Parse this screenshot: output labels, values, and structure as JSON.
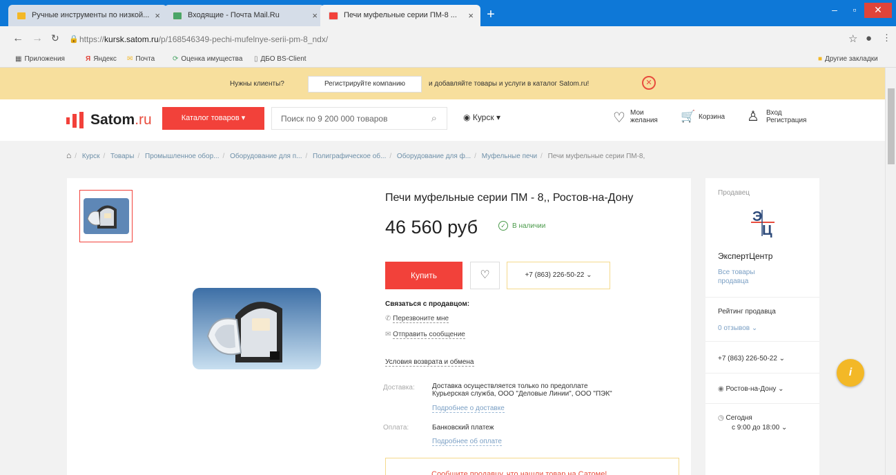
{
  "browser": {
    "tabs": [
      {
        "title": "Ручные инструменты по низкой..."
      },
      {
        "title": "Входящие - Почта Mail.Ru"
      },
      {
        "title": "Печи муфельные серии ПМ-8 ..."
      }
    ],
    "url_host": "kursk.satom.ru",
    "url_prefix": "https://",
    "url_path": "/p/168546349-pechi-mufelnye-serii-pm-8_ndx/",
    "bookmarks": [
      "Приложения",
      "Яндекс",
      "Почта",
      "Оценка имущества",
      "ДБО BS-Client"
    ],
    "other_bookmarks": "Другие закладки"
  },
  "promo": {
    "question": "Нужны клиенты?",
    "register_label": "Регистрируйте компанию",
    "text": "и добавляйте товары и услуги в каталог Satom.ru!"
  },
  "header": {
    "logo_main": "Satom",
    "logo_domain": ".ru",
    "catalog_label": "Каталог товаров",
    "search_placeholder": "Поиск по 9 200 000 товаров",
    "city": "Курск",
    "wishlist_l1": "Мои",
    "wishlist_l2": "желания",
    "cart_label": "Корзина",
    "login_l1": "Вход",
    "login_l2": "Регистрация"
  },
  "breadcrumbs": [
    "Курск",
    "Товары",
    "Промышленное обор...",
    "Оборудование для п...",
    "Полиграфическое об...",
    "Оборудование для ф...",
    "Муфельные печи",
    "Печи муфельные серии ПМ-8,"
  ],
  "product": {
    "title": "Печи муфельные серии ПМ - 8,, Ростов-на-Дону",
    "price": "46 560 руб",
    "stock": "В наличии",
    "buy_label": "Купить",
    "phone": "+7 (863) 226-50-22",
    "contact_heading": "Связаться с продавцом",
    "call_me": "Перезвоните мне",
    "send_message": "Отправить сообщение",
    "returns": "Условия возврата и обмена",
    "delivery_label": "Доставка:",
    "delivery_line1": "Доставка осуществляется только по предоплате",
    "delivery_line2": "Курьерская служба,  ООО \"Деловые Линии\",  ООО \"ПЭК\"",
    "delivery_more": "Подробнее о доставке",
    "payment_label": "Оплата:",
    "payment_text": "Банковский платеж",
    "payment_more": "Подробнее об оплате",
    "notice": "Сообщите продавцу, что нашли товар на Сатоме!"
  },
  "seller": {
    "label": "Продавец",
    "name": "ЭкспертЦентр",
    "all_goods_l1": "Все товары",
    "all_goods_l2": "продавца",
    "rating_label": "Рейтинг продавца",
    "reviews": "0 отзывов",
    "phone": "+7 (863) 226-50-22",
    "city": "Ростов-на-Дону",
    "today": "Сегодня",
    "hours": "с 9:00 до 18:00"
  },
  "colors": {
    "accent_red": "#f2413a",
    "promo_bg": "#f7df9d",
    "chrome_blue": "#0e78d7",
    "info_yellow": "#f3b827"
  }
}
